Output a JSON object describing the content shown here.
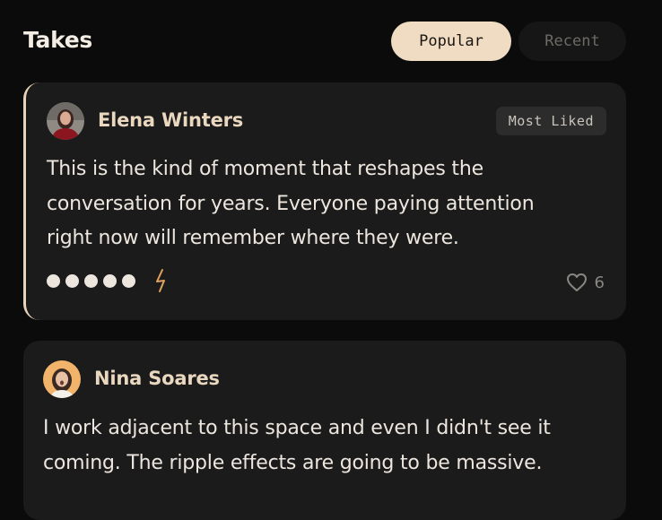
{
  "header": {
    "title": "Takes",
    "tabs": [
      {
        "label": "Popular",
        "active": true
      },
      {
        "label": "Recent",
        "active": false
      }
    ]
  },
  "takes": [
    {
      "author": "Elena Winters",
      "badge": "Most Liked",
      "text_lines": [
        "This is the kind of moment that reshapes the",
        "conversation for years. Everyone paying attention",
        "right now will remember where they were."
      ],
      "rating_dots": 5,
      "reaction_icon": "lightning-bolt-icon",
      "like_icon": "heart-outline-icon",
      "likes": "6"
    },
    {
      "author": "Nina Soares",
      "text_lines": [
        "I work adjacent to this space and even I didn't see it",
        "coming. The ripple effects are going to be massive."
      ]
    }
  ],
  "colors": {
    "background": "#0b0b0b",
    "card": "#1b1b1b",
    "accent": "#f0dcc2",
    "author_name": "#ead7bf",
    "bolt": "#e0a060"
  }
}
